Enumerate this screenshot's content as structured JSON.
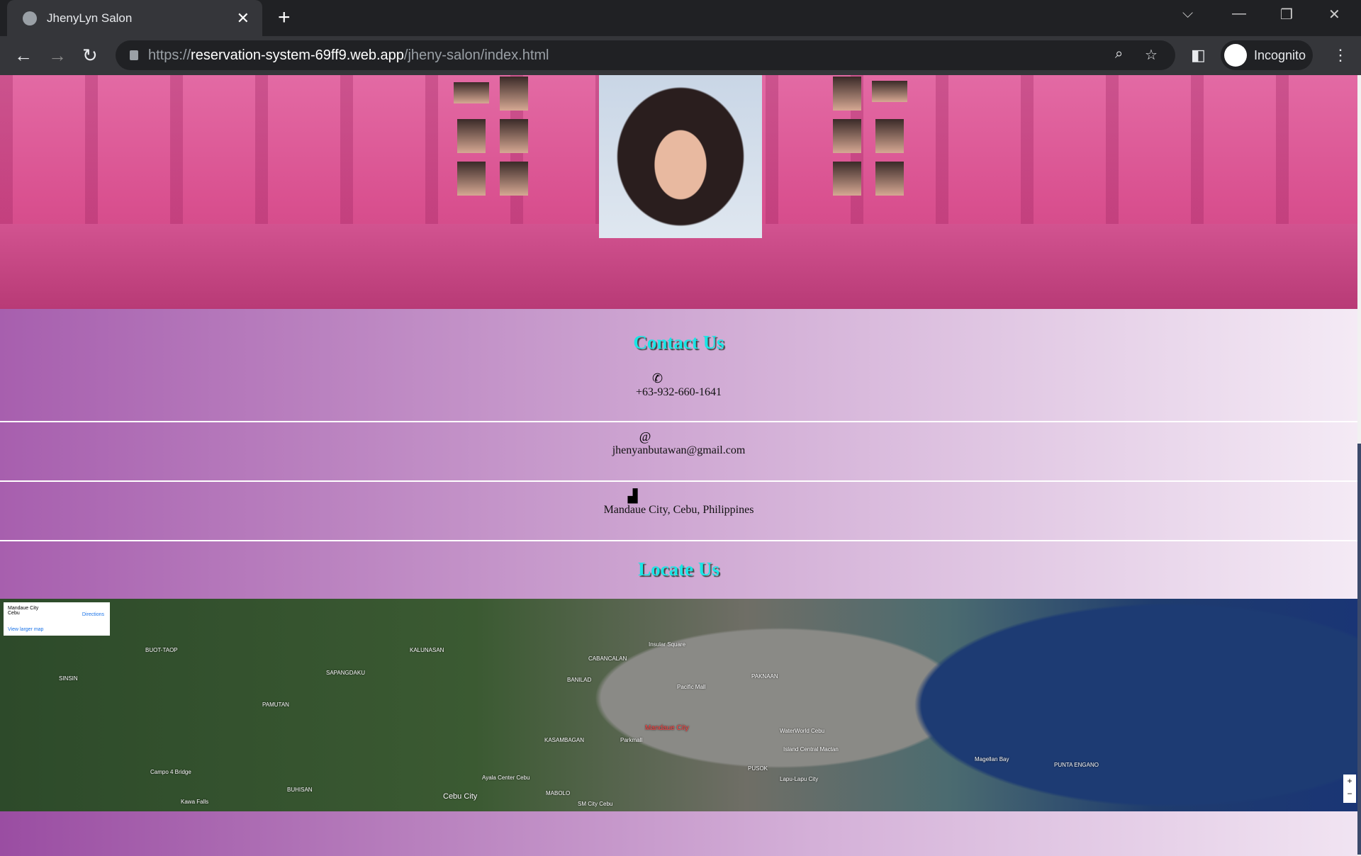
{
  "browser": {
    "tab_title": "JhenyLyn Salon",
    "url_scheme": "https://",
    "url_host": "reservation-system-69ff9.web.app",
    "url_path": "/jheny-salon/index.html",
    "profile_label": "Incognito"
  },
  "contact": {
    "heading": "Contact Us",
    "phone": "+63-932-660-1641",
    "email": "jhenyanbutawan@gmail.com",
    "address": "Mandaue City, Cebu, Philippines"
  },
  "locate": {
    "heading": "Locate Us"
  },
  "map": {
    "place_name": "Mandaue City",
    "place_region": "Cebu",
    "directions_label": "Directions",
    "larger_map_label": "View larger map",
    "labels": [
      "Mandaue City",
      "Cebu City",
      "Lapu-Lapu City",
      "BANILAD",
      "CABANCALAN",
      "PAKNAAN",
      "KASAMBAGAN",
      "MABOLO",
      "PUSOK",
      "Pacific Mall",
      "Parkmall",
      "Insular Square",
      "SM City Cebu",
      "Ayala Center Cebu",
      "Magellan Bay",
      "PUNTA ENGANO",
      "BUHISAN",
      "SAPANGDAKU",
      "KALUNASAN",
      "PAMUTAN",
      "SINSIN",
      "BUOT-TAOP",
      "Kawa Falls",
      "Campo 4 Bridge",
      "Island Central Mactan",
      "WaterWorld Cebu"
    ]
  }
}
